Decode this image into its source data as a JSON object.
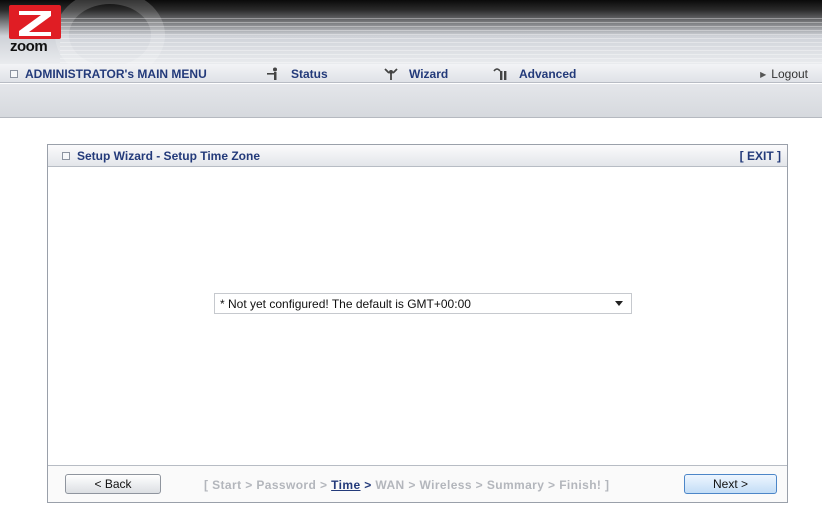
{
  "brand": {
    "logo_text": "zoom",
    "colors": {
      "logo_red": "#e01d24",
      "nav_text": "#233a7a"
    }
  },
  "menu": {
    "admin_label": "ADMINISTRATOR's MAIN MENU",
    "status_label": "Status",
    "wizard_label": "Wizard",
    "advanced_label": "Advanced",
    "logout_label": "Logout",
    "icons": {
      "status": "person-icon",
      "wizard": "wizard-icon",
      "advanced": "tools-icon",
      "logout": "arrow-right-icon"
    }
  },
  "panel": {
    "title": "Setup Wizard - Setup Time Zone",
    "exit_label": "[ EXIT ]",
    "timezone_select": {
      "selected": "* Not yet configured! The default is GMT+00:00"
    }
  },
  "footer": {
    "back_label": "< Back",
    "next_label": "Next >",
    "steps": {
      "open": "[ Start > Password > ",
      "current": "Time",
      "current_sep": " > ",
      "rest": "WAN > Wireless > Summary > Finish! ]"
    }
  }
}
